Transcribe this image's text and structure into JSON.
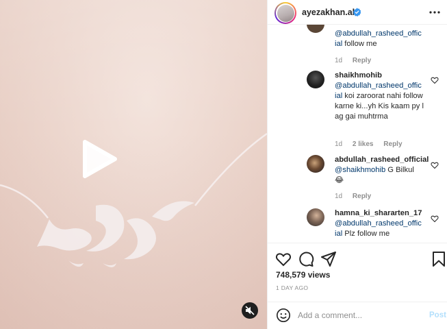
{
  "post": {
    "username": "ayezakhan.ak",
    "verified_icon": "verified-badge-icon",
    "more_icon": "more-horizontal-icon"
  },
  "comments": [
    {
      "user": "",
      "mention": "@abdullah_rasheed_offic\nial",
      "text": " follow me",
      "age": "1d",
      "likes": "",
      "reply": "Reply"
    },
    {
      "user": "shaikhmohib",
      "mention": "@abdullah_rasheed_offic\nial",
      "text": " koi zaroorat nahi follow karne ki...yh Kis kaam py lag gai muhtrma",
      "age": "1d",
      "likes": "2 likes",
      "reply": "Reply"
    },
    {
      "user": "abdullah_rasheed_official",
      "mention": "@shaikhmohib",
      "text": " G Bilkul",
      "emoji": "😂",
      "age": "1d",
      "likes": "",
      "reply": "Reply"
    },
    {
      "user": "hamna_ki_shararten_17",
      "mention": "@abdullah_rasheed_offic\nial",
      "text": " Plz follow me"
    }
  ],
  "stats": {
    "views": "748,579 views",
    "age": "1 DAY AGO"
  },
  "composer": {
    "placeholder": "Add a comment...",
    "post_label": "Post"
  },
  "colors": {
    "link": "#00376b",
    "meta": "#8e8e8e",
    "post_disabled": "#b2dffc"
  }
}
